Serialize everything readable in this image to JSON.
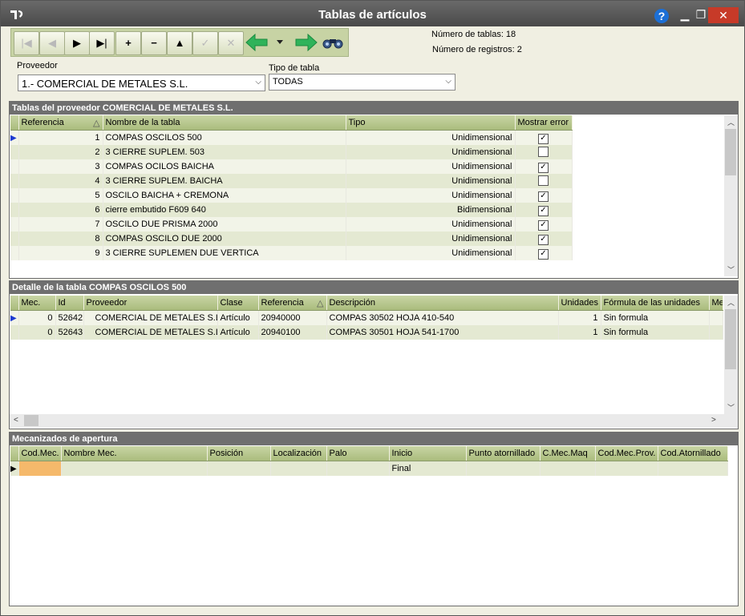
{
  "window": {
    "title": "Tablas de artículos",
    "help_label": "?",
    "min_label": "▁",
    "max_label": "❐",
    "close_label": "✕"
  },
  "toolbar": {
    "buttons": [
      {
        "name": "first-button",
        "glyph": "|◀",
        "enabled": false
      },
      {
        "name": "prev-button",
        "glyph": "◀",
        "enabled": false
      },
      {
        "name": "next-button",
        "glyph": "▶",
        "enabled": true
      },
      {
        "name": "last-button",
        "glyph": "▶|",
        "enabled": true
      },
      {
        "name": "add-button",
        "glyph": "+",
        "enabled": true
      },
      {
        "name": "delete-button",
        "glyph": "−",
        "enabled": true
      },
      {
        "name": "edit-button",
        "glyph": "▲",
        "enabled": true
      },
      {
        "name": "confirm-button",
        "glyph": "✓",
        "enabled": false
      },
      {
        "name": "cancel-button",
        "glyph": "✕",
        "enabled": false
      }
    ]
  },
  "info": {
    "num_tablas": "Número de tablas: 18",
    "num_registros": "Número de registros: 2"
  },
  "filters": {
    "proveedor_label": "Proveedor",
    "proveedor_value": "1.- COMERCIAL DE METALES S.L.",
    "tipo_label": "Tipo de tabla",
    "tipo_value": "TODAS"
  },
  "tablas": {
    "title": "Tablas del proveedor COMERCIAL DE METALES S.L.",
    "columns": [
      "Referencia",
      "Nombre de la tabla",
      "Tipo",
      "Mostrar error"
    ],
    "rows": [
      {
        "ref": "1",
        "name": "COMPAS OSCILOS 500",
        "tipo": "Unidimensional",
        "error": true
      },
      {
        "ref": "2",
        "name": "3 CIERRE SUPLEM. 503",
        "tipo": "Unidimensional",
        "error": false
      },
      {
        "ref": "3",
        "name": "COMPAS OCILOS BAICHA",
        "tipo": "Unidimensional",
        "error": true
      },
      {
        "ref": "4",
        "name": "3 CIERRE SUPLEM. BAICHA",
        "tipo": "Unidimensional",
        "error": false
      },
      {
        "ref": "5",
        "name": "OSCILO BAICHA + CREMONA",
        "tipo": "Unidimensional",
        "error": true
      },
      {
        "ref": "6",
        "name": "cierre embutido F609 640",
        "tipo": "Bidimensional",
        "error": true
      },
      {
        "ref": "7",
        "name": "OSCILO DUE PRISMA 2000",
        "tipo": "Unidimensional",
        "error": true
      },
      {
        "ref": "8",
        "name": "COMPAS OSCILO DUE 2000",
        "tipo": "Unidimensional",
        "error": true
      },
      {
        "ref": "9",
        "name": "3 CIERRE SUPLEMEN DUE VERTICA",
        "tipo": "Unidimensional",
        "error": true
      }
    ]
  },
  "detalle": {
    "title": "Detalle de la tabla COMPAS OSCILOS 500",
    "columns": [
      "Mec.",
      "Id",
      "Proveedor",
      "Clase",
      "Referencia",
      "Descripción",
      "Unidades",
      "Fórmula de las unidades",
      "Me"
    ],
    "rows": [
      {
        "mec": "0",
        "id": "52642",
        "prov": "COMERCIAL DE METALES S.L.",
        "clase": "Artículo",
        "ref": "20940000",
        "desc": "COMPAS 30502 HOJA 410-540",
        "uds": "1",
        "formula": "Sin formula"
      },
      {
        "mec": "0",
        "id": "52643",
        "prov": "COMERCIAL DE METALES S.L.",
        "clase": "Artículo",
        "ref": "20940100",
        "desc": "COMPAS 30501 HOJA 541-1700",
        "uds": "1",
        "formula": "Sin formula"
      }
    ]
  },
  "mecanizados": {
    "title": "Mecanizados de apertura",
    "columns": [
      "Cod.Mec.",
      "Nombre Mec.",
      "Posición",
      "Localización",
      "Palo",
      "Inicio",
      "Punto atornillado",
      "C.Mec.Maq",
      "Cod.Mec.Prov.",
      "Cod.Atornillado"
    ],
    "row": {
      "inicio": "Final"
    }
  }
}
